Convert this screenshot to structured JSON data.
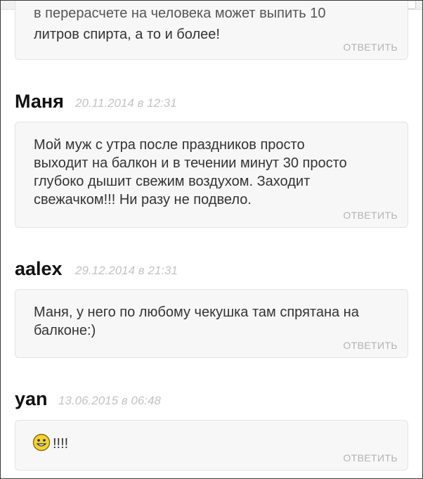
{
  "comments": [
    {
      "text_partial": "в перерасчете на человека может выпить 10",
      "text": "литров спирта, а то и более!",
      "reply": "ОТВЕТИТЬ"
    },
    {
      "author": "Маня",
      "date": "20.11.2014 в 12:31",
      "lines": [
        "Мой муж с утра после праздников просто",
        "выходит на балкон и в течении минут 30 просто",
        "глубоко дышит свежим воздухом. Заходит",
        "свежачком!!! Ни разу не подвело."
      ],
      "reply": "ОТВЕТИТЬ"
    },
    {
      "author": "aalex",
      "date": "29.12.2014 в 21:31",
      "lines": [
        "Маня, у него по любому чекушка там спрятана на",
        "балконе:)"
      ],
      "reply": "ОТВЕТИТЬ"
    },
    {
      "author": "yan",
      "date": "13.06.2015 в 06:48",
      "emoji": "smiley-emoji",
      "text": "!!!!",
      "reply": "ОТВЕТИТЬ"
    }
  ]
}
